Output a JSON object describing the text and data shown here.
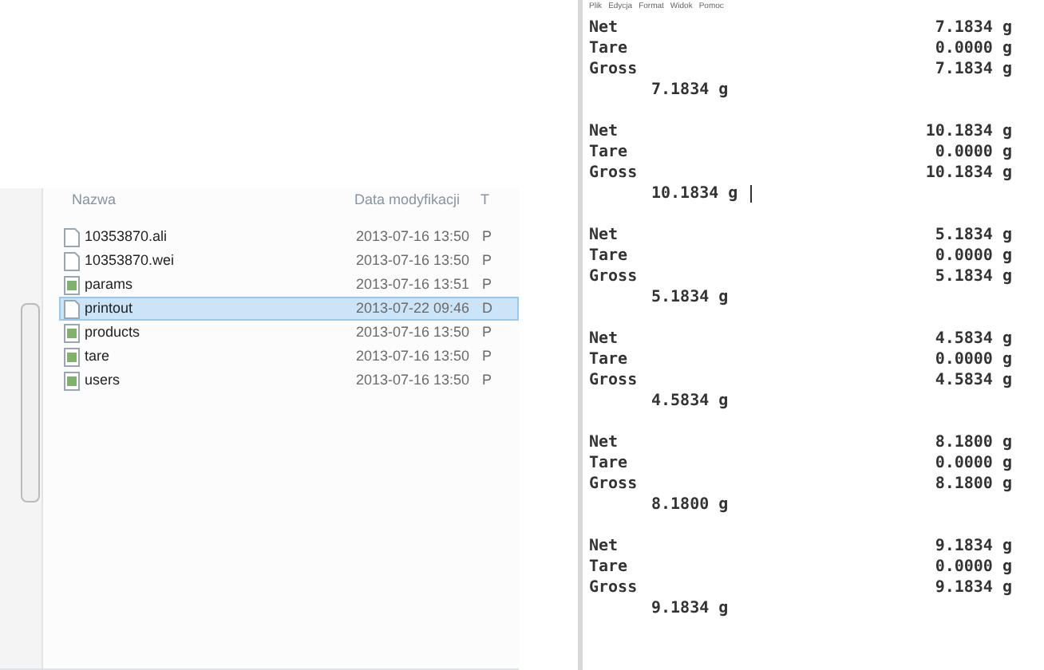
{
  "explorer": {
    "columns": [
      "Nazwa",
      "Data modyfikacji",
      "T"
    ],
    "files": [
      {
        "name": "10353870.ali",
        "date": "2013-07-16 13:50",
        "type": "P",
        "kind": "blank",
        "selected": false
      },
      {
        "name": "10353870.wei",
        "date": "2013-07-16 13:50",
        "type": "P",
        "kind": "blank",
        "selected": false
      },
      {
        "name": "params",
        "date": "2013-07-16 13:51",
        "type": "P",
        "kind": "text",
        "selected": false
      },
      {
        "name": "printout",
        "date": "2013-07-22 09:46",
        "type": "D",
        "kind": "blank",
        "selected": true
      },
      {
        "name": "products",
        "date": "2013-07-16 13:50",
        "type": "P",
        "kind": "text",
        "selected": false
      },
      {
        "name": "tare",
        "date": "2013-07-16 13:50",
        "type": "P",
        "kind": "text",
        "selected": false
      },
      {
        "name": "users",
        "date": "2013-07-16 13:50",
        "type": "P",
        "kind": "text",
        "selected": false
      }
    ]
  },
  "notepad": {
    "menu": [
      "Plik",
      "Edycja",
      "Format",
      "Widok",
      "Pomoc"
    ],
    "records": [
      {
        "lines": [
          {
            "label": "Net",
            "value": "7.1834 g"
          },
          {
            "label": "Tare",
            "value": "0.0000 g"
          },
          {
            "label": "Gross",
            "value": "7.1834 g"
          }
        ],
        "total": "7.1834 g",
        "cursor": false
      },
      {
        "lines": [
          {
            "label": "Net",
            "value": "10.1834 g"
          },
          {
            "label": "Tare",
            "value": "0.0000 g"
          },
          {
            "label": "Gross",
            "value": "10.1834 g"
          }
        ],
        "total": "10.1834 g",
        "cursor": true
      },
      {
        "lines": [
          {
            "label": "Net",
            "value": "5.1834 g"
          },
          {
            "label": "Tare",
            "value": "0.0000 g"
          },
          {
            "label": "Gross",
            "value": "5.1834 g"
          }
        ],
        "total": "5.1834 g",
        "cursor": false
      },
      {
        "lines": [
          {
            "label": "Net",
            "value": "4.5834 g"
          },
          {
            "label": "Tare",
            "value": "0.0000 g"
          },
          {
            "label": "Gross",
            "value": "4.5834 g"
          }
        ],
        "total": "4.5834 g",
        "cursor": false
      },
      {
        "lines": [
          {
            "label": "Net",
            "value": "8.1800 g"
          },
          {
            "label": "Tare",
            "value": "0.0000 g"
          },
          {
            "label": "Gross",
            "value": "8.1800 g"
          }
        ],
        "total": "8.1800 g",
        "cursor": false
      },
      {
        "lines": [
          {
            "label": "Net",
            "value": "9.1834 g"
          },
          {
            "label": "Tare",
            "value": "0.0000 g"
          },
          {
            "label": "Gross",
            "value": "9.1834 g"
          }
        ],
        "total": "9.1834 g",
        "cursor": false
      }
    ]
  }
}
